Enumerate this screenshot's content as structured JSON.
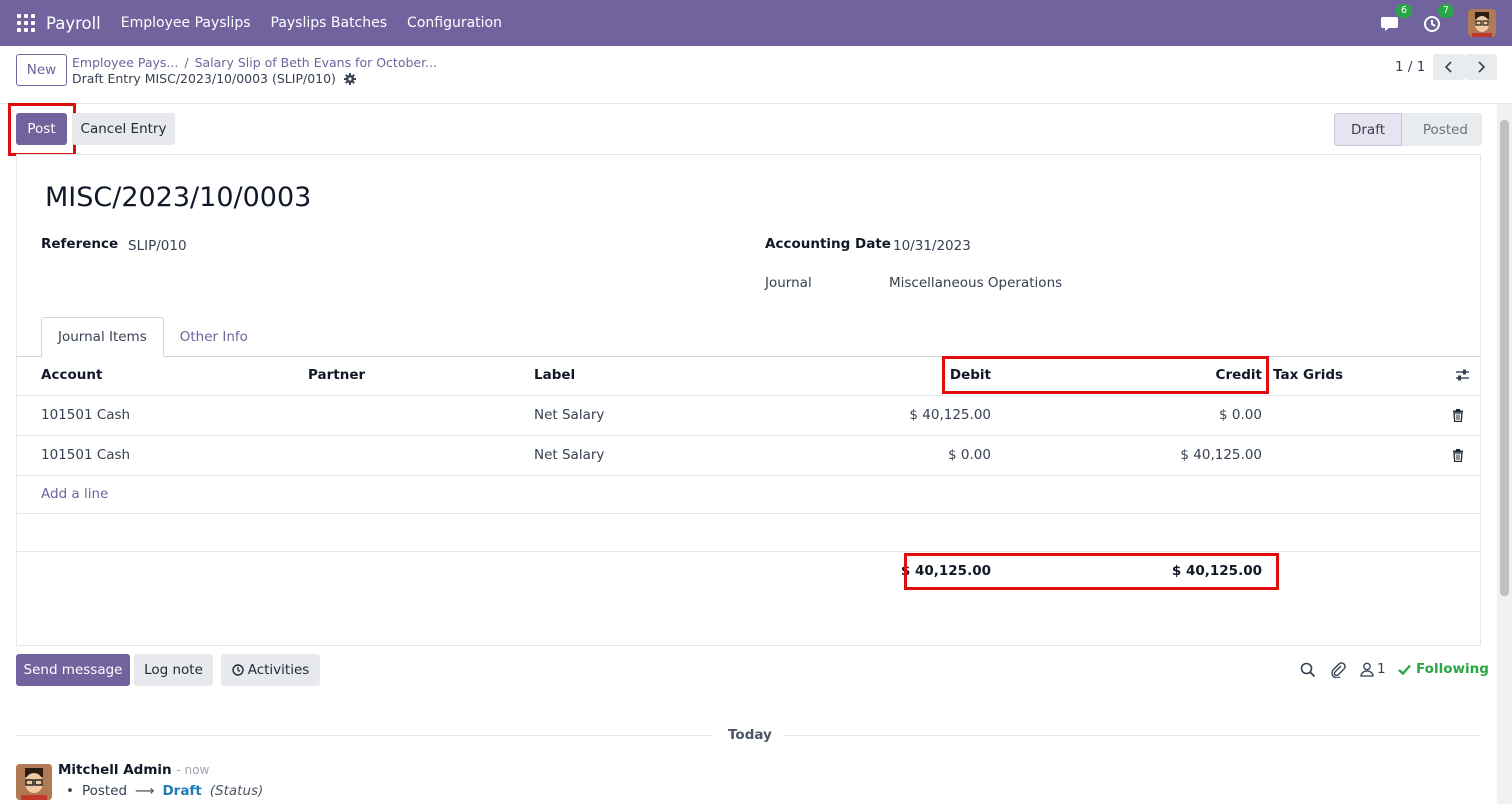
{
  "navbar": {
    "app_name": "Payroll",
    "menu": [
      "Employee Payslips",
      "Payslips Batches",
      "Configuration"
    ],
    "messages_count": "6",
    "activities_count": "7"
  },
  "control_panel": {
    "new_label": "New",
    "breadcrumb": [
      "Employee Pays...",
      "Salary Slip of Beth Evans for October..."
    ],
    "record_title": "Draft Entry MISC/2023/10/0003 (SLIP/010)",
    "pager": "1 / 1"
  },
  "actions": {
    "post_label": "Post",
    "cancel_label": "Cancel Entry"
  },
  "status": {
    "steps": [
      "Draft",
      "Posted"
    ],
    "current": "Draft"
  },
  "form": {
    "name": "MISC/2023/10/0003",
    "reference_label": "Reference",
    "reference_value": "SLIP/010",
    "date_label": "Accounting Date",
    "date_value": "10/31/2023",
    "journal_label": "Journal",
    "journal_value": "Miscellaneous Operations"
  },
  "tabs": [
    "Journal Items",
    "Other Info"
  ],
  "table": {
    "headers": [
      "Account",
      "Partner",
      "Label",
      "Debit",
      "Credit",
      "Tax Grids"
    ],
    "rows": [
      {
        "account": "101501 Cash",
        "partner": "",
        "label": "Net Salary",
        "debit": "$ 40,125.00",
        "credit": "$ 0.00"
      },
      {
        "account": "101501 Cash",
        "partner": "",
        "label": "Net Salary",
        "debit": "$ 0.00",
        "credit": "$ 40,125.00"
      }
    ],
    "add_line": "Add a line",
    "total_debit": "$ 40,125.00",
    "total_credit": "$ 40,125.00"
  },
  "chatter": {
    "send_message": "Send message",
    "log_note": "Log note",
    "activities": "Activities",
    "followers_count": "1",
    "following_label": "Following",
    "date_separator": "Today",
    "message": {
      "author": "Mitchell Admin",
      "time": "- now",
      "old_value": "Posted",
      "new_value": "Draft",
      "field": "(Status)"
    }
  },
  "colors": {
    "brand": "#71639e",
    "highlight": "#e00d0d",
    "following": "#28a745"
  }
}
